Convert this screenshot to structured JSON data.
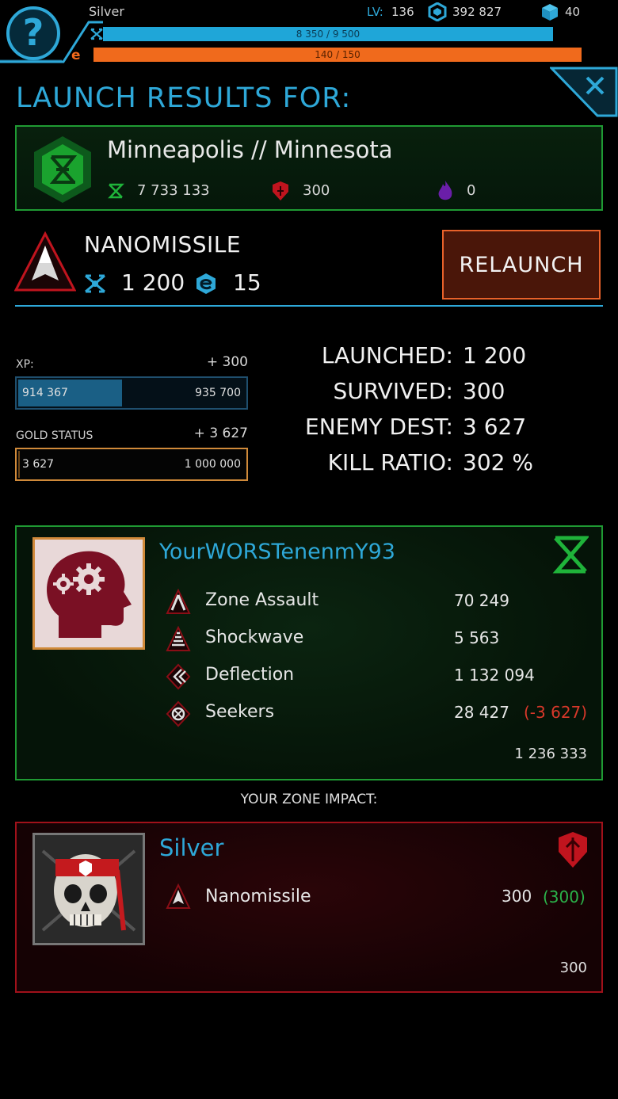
{
  "hud": {
    "player_name": "Silver",
    "level_label": "LV:",
    "level": "136",
    "credits": "392 827",
    "credits_icon": "hex-energy-icon",
    "cubes": "40",
    "cubes_icon": "cube-icon",
    "xp_bar_text": "8 350 / 9 500",
    "xp_bar_fraction": 0.879,
    "energy_bar_text": "140 / 150",
    "energy_bar_fraction": 0.933,
    "help_label": "?"
  },
  "title": "LAUNCH RESULTS FOR:",
  "zone": {
    "name": "Minneapolis // Minnesota",
    "faction": "green",
    "stats": [
      {
        "icon": "green-faction-icon",
        "value": "7 733 133"
      },
      {
        "icon": "red-faction-shield-icon",
        "value": "300"
      },
      {
        "icon": "purple-flame-icon",
        "value": "0"
      }
    ]
  },
  "missile": {
    "name": "NANOMISSILE",
    "cost": "1 200",
    "energy": "15",
    "relaunch_label": "RELAUNCH"
  },
  "progress": {
    "xp_label": "XP:",
    "xp_gain": "+ 300",
    "xp_current": "914 367",
    "xp_max": "935 700",
    "xp_fill_fraction": 0.45,
    "gold_label": "GOLD STATUS",
    "gold_gain": "+ 3 627",
    "gold_current": "3 627",
    "gold_max": "1 000 000",
    "gold_fill_fraction": 0.004
  },
  "results": [
    {
      "label": "LAUNCHED:",
      "value": "1 200"
    },
    {
      "label": "SURVIVED:",
      "value": "300"
    },
    {
      "label": "ENEMY DEST:",
      "value": "3 627"
    },
    {
      "label": "KILL RATIO:",
      "value": "302 %"
    }
  ],
  "enemy": {
    "name": "YourWORSTenenmY93",
    "defenses": [
      {
        "icon": "zone-assault-icon",
        "label": "Zone Assault",
        "value": "70 249",
        "loss": ""
      },
      {
        "icon": "shockwave-icon",
        "label": "Shockwave",
        "value": "5 563",
        "loss": ""
      },
      {
        "icon": "deflection-icon",
        "label": "Deflection",
        "value": "1 132 094",
        "loss": ""
      },
      {
        "icon": "seekers-icon",
        "label": "Seekers",
        "value": "28 427",
        "loss": "(-3 627)"
      }
    ],
    "total": "1 236 333"
  },
  "impact_title": "YOUR ZONE IMPACT:",
  "own": {
    "name": "Silver",
    "row": {
      "icon": "nanomissile-icon",
      "label": "Nanomissile",
      "value": "300",
      "gain": "(300)"
    },
    "total": "300"
  },
  "colors": {
    "accent_blue": "#2ea8d8",
    "energy_orange": "#f06a1c",
    "green_faction": "#1f9a33",
    "red_faction": "#a0111a",
    "loss_red": "#d8382a",
    "gain_green": "#2bb44a"
  }
}
